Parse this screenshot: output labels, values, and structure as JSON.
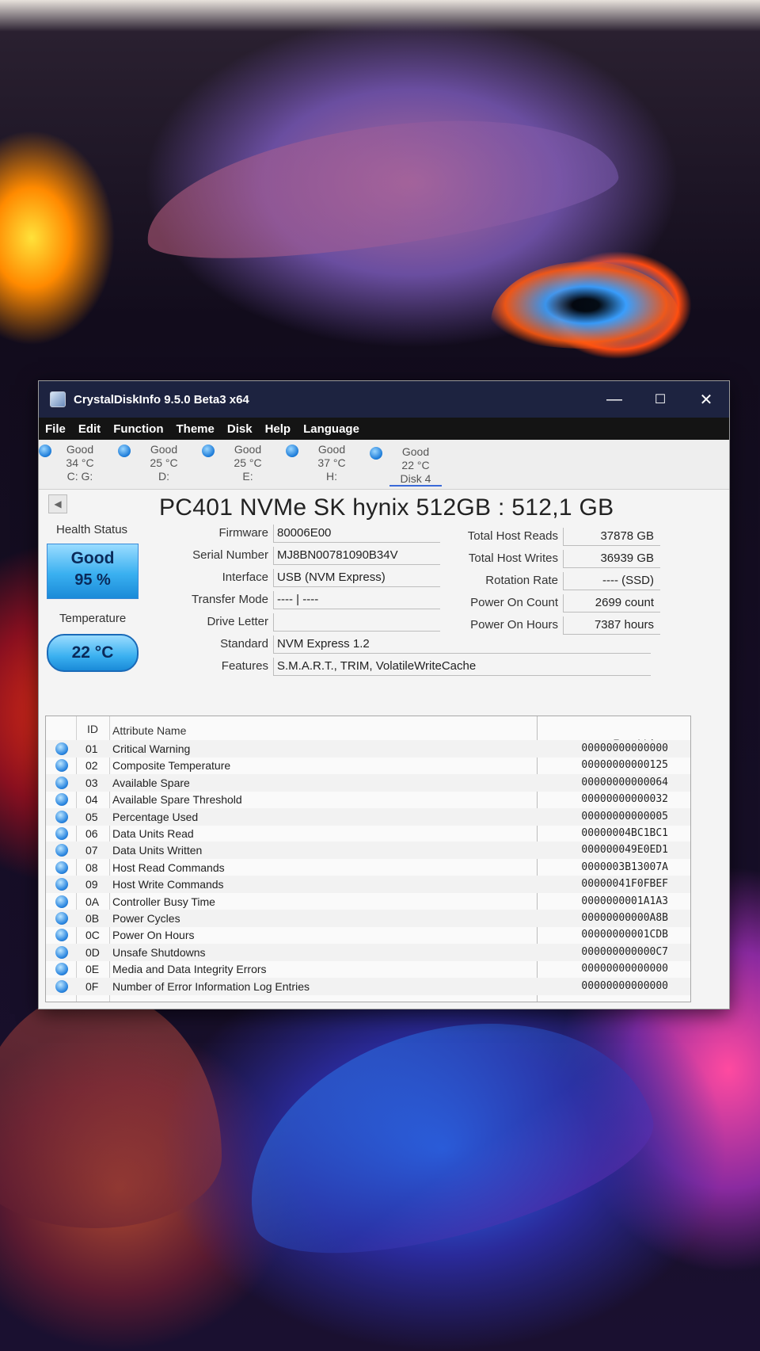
{
  "window": {
    "title": "CrystalDiskInfo 9.5.0 Beta3 x64",
    "minimize": "—",
    "maximize": "☐",
    "close": "✕"
  },
  "menu": [
    "File",
    "Edit",
    "Function",
    "Theme",
    "Disk",
    "Help",
    "Language"
  ],
  "disks": [
    {
      "status": "Good",
      "temp": "34 °C",
      "label": "C: G:"
    },
    {
      "status": "Good",
      "temp": "25 °C",
      "label": "D:"
    },
    {
      "status": "Good",
      "temp": "25 °C",
      "label": "E:"
    },
    {
      "status": "Good",
      "temp": "37 °C",
      "label": "H:"
    },
    {
      "status": "Good",
      "temp": "22 °C",
      "label": "Disk 4"
    }
  ],
  "drive": {
    "title": "PC401 NVMe SK hynix 512GB : 512,1 GB",
    "health_label": "Health Status",
    "health_status": "Good",
    "health_percent": "95 %",
    "temperature_label": "Temperature",
    "temperature": "22 °C",
    "firmware_label": "Firmware",
    "firmware": "80006E00",
    "serial_label": "Serial Number",
    "serial": "MJ8BN00781090B34V",
    "interface_label": "Interface",
    "interface": "USB (NVM Express)",
    "transfer_label": "Transfer Mode",
    "transfer": "---- | ----",
    "letter_label": "Drive Letter",
    "letter": "",
    "standard_label": "Standard",
    "standard": "NVM Express 1.2",
    "features_label": "Features",
    "features": "S.M.A.R.T., TRIM, VolatileWriteCache",
    "reads_label": "Total Host Reads",
    "reads": "37878 GB",
    "writes_label": "Total Host Writes",
    "writes": "36939 GB",
    "rotation_label": "Rotation Rate",
    "rotation": "---- (SSD)",
    "power_count_label": "Power On Count",
    "power_count": "2699 count",
    "power_hours_label": "Power On Hours",
    "power_hours": "7387 hours"
  },
  "smart": {
    "headers": {
      "id": "ID",
      "name": "Attribute Name",
      "raw": "Raw Values"
    },
    "rows": [
      {
        "id": "01",
        "name": "Critical Warning",
        "raw": "00000000000000"
      },
      {
        "id": "02",
        "name": "Composite Temperature",
        "raw": "00000000000125"
      },
      {
        "id": "03",
        "name": "Available Spare",
        "raw": "00000000000064"
      },
      {
        "id": "04",
        "name": "Available Spare Threshold",
        "raw": "00000000000032"
      },
      {
        "id": "05",
        "name": "Percentage Used",
        "raw": "00000000000005"
      },
      {
        "id": "06",
        "name": "Data Units Read",
        "raw": "00000004BC1BC1"
      },
      {
        "id": "07",
        "name": "Data Units Written",
        "raw": "000000049E0ED1"
      },
      {
        "id": "08",
        "name": "Host Read Commands",
        "raw": "0000003B13007A"
      },
      {
        "id": "09",
        "name": "Host Write Commands",
        "raw": "00000041F0FBEF"
      },
      {
        "id": "0A",
        "name": "Controller Busy Time",
        "raw": "0000000001A1A3"
      },
      {
        "id": "0B",
        "name": "Power Cycles",
        "raw": "00000000000A8B"
      },
      {
        "id": "0C",
        "name": "Power On Hours",
        "raw": "00000000001CDB"
      },
      {
        "id": "0D",
        "name": "Unsafe Shutdowns",
        "raw": "000000000000C7"
      },
      {
        "id": "0E",
        "name": "Media and Data Integrity Errors",
        "raw": "00000000000000"
      },
      {
        "id": "0F",
        "name": "Number of Error Information Log Entries",
        "raw": "00000000000000"
      }
    ]
  },
  "colors": {
    "titlebar": "#1d2340",
    "menubar": "#141414",
    "health_good": "#3ab0f0"
  }
}
